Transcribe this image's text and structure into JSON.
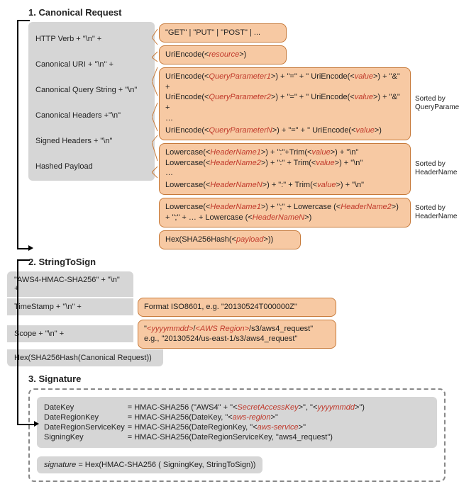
{
  "section1": {
    "title": "1. Canonical Request",
    "left": {
      "l1": "HTTP Verb + \"\\n\" +",
      "l2": "Canonical URI + \"\\n\" +",
      "l3": "Canonical Query String + \"\\n\"",
      "l4": "Canonical Headers +\"\\n\"",
      "l5": "Signed Headers + \"\\n\"",
      "l6": "Hashed Payload"
    },
    "verbs": "\"GET\" | \"PUT\" | \"POST\" | ...",
    "uri_a": "UriEncode(<",
    "uri_b": "resource",
    "uri_c": ">)",
    "qp": {
      "a1": "UriEncode(<",
      "a2": "QueryParameter1",
      "a3": ">) + \"=\" + \" UriEncode(<",
      "a4": "value",
      "a5": ">) + \"&\" +",
      "b1": "UriEncode(<",
      "b2": "QueryParameter2",
      "b3": ">) + \"=\" + \" UriEncode(<",
      "b4": "value",
      "b5": ">) + \"&\" +",
      "e": "…",
      "c1": "UriEncode(<",
      "c2": "QueryParameterN",
      "c3": ">) + \"=\" + \" UriEncode(<",
      "c4": "value",
      "c5": ">)"
    },
    "hdr": {
      "a1": "Lowercase(<",
      "a2": "HeaderName1",
      "a3": ">) + \":\"+Trim(<",
      "a4": "value",
      "a5": ">) + \"\\n\"",
      "b1": "Lowercase(<",
      "b2": "HeaderName2",
      "b3": ">) + \":\" + Trim(<",
      "b4": "value",
      "b5": ">) + \"\\n\"",
      "e": "…",
      "c1": "Lowercase(<",
      "c2": "HeaderNameN",
      "c3": ">) + \":\" + Trim(<",
      "c4": "value",
      "c5": ">) + \"\\n\""
    },
    "sh": {
      "a1": "Lowercase(<",
      "a2": "HeaderName1",
      "a3": ">) + \";\" + Lowercase (<",
      "a4": "HeaderName2",
      "a5": ">)",
      "b1": "+ \";\" + … + Lowercase (<",
      "b2": "HeaderNameN",
      "b3": ">)"
    },
    "payload_a": "Hex(SHA256Hash(<",
    "payload_b": "payload",
    "payload_c": ">))",
    "sort_qp": "Sorted by QueryParameter",
    "sort_hn": "Sorted by HeaderName"
  },
  "section2": {
    "title": "2. StringToSign",
    "l1": "\"AWS4-HMAC-SHA256\" + \"\\n\" +",
    "l2": "TimeStamp + \"\\n\" +",
    "l3": "Scope + \"\\n\" +",
    "l4": "Hex(SHA256Hash(Canonical Request))",
    "ts": "Format ISO8601,  e.g. \"20130524T000000Z\"",
    "scope_a": "\"",
    "scope_b": "<yyyymmdd>",
    "scope_c": "/",
    "scope_d": "<AWS Region>",
    "scope_e": "/s3/aws4_request\"",
    "scope_eg": "e.g., \"20130524/us-east-1/s3/aws4_request\""
  },
  "section3": {
    "title": "3. Signature",
    "r1k": "DateKey",
    "r1a": "= HMAC-SHA256 (\"AWS4\" + \"<",
    "r1b": "SecretAccessKey",
    "r1c": ">\", \"<",
    "r1d": "yyyymmdd",
    "r1e": ">\")",
    "r2k": "DateRegionKey",
    "r2a": "= HMAC-SHA256(DateKey, \"<",
    "r2b": "aws-region",
    "r2c": ">\"",
    "r3k": "DateRegionServiceKey",
    "r3a": "= HMAC-SHA256(DateRegionKey, \"<",
    "r3b": "aws-service",
    "r3c": ">\"",
    "r4k": "SigningKey",
    "r4v": "= HMAC-SHA256(DateRegionServiceKey, \"aws4_request\")",
    "res_a": "signature",
    "res_b": " =  Hex(HMAC-SHA256 ( SigningKey, StringToSign))"
  }
}
